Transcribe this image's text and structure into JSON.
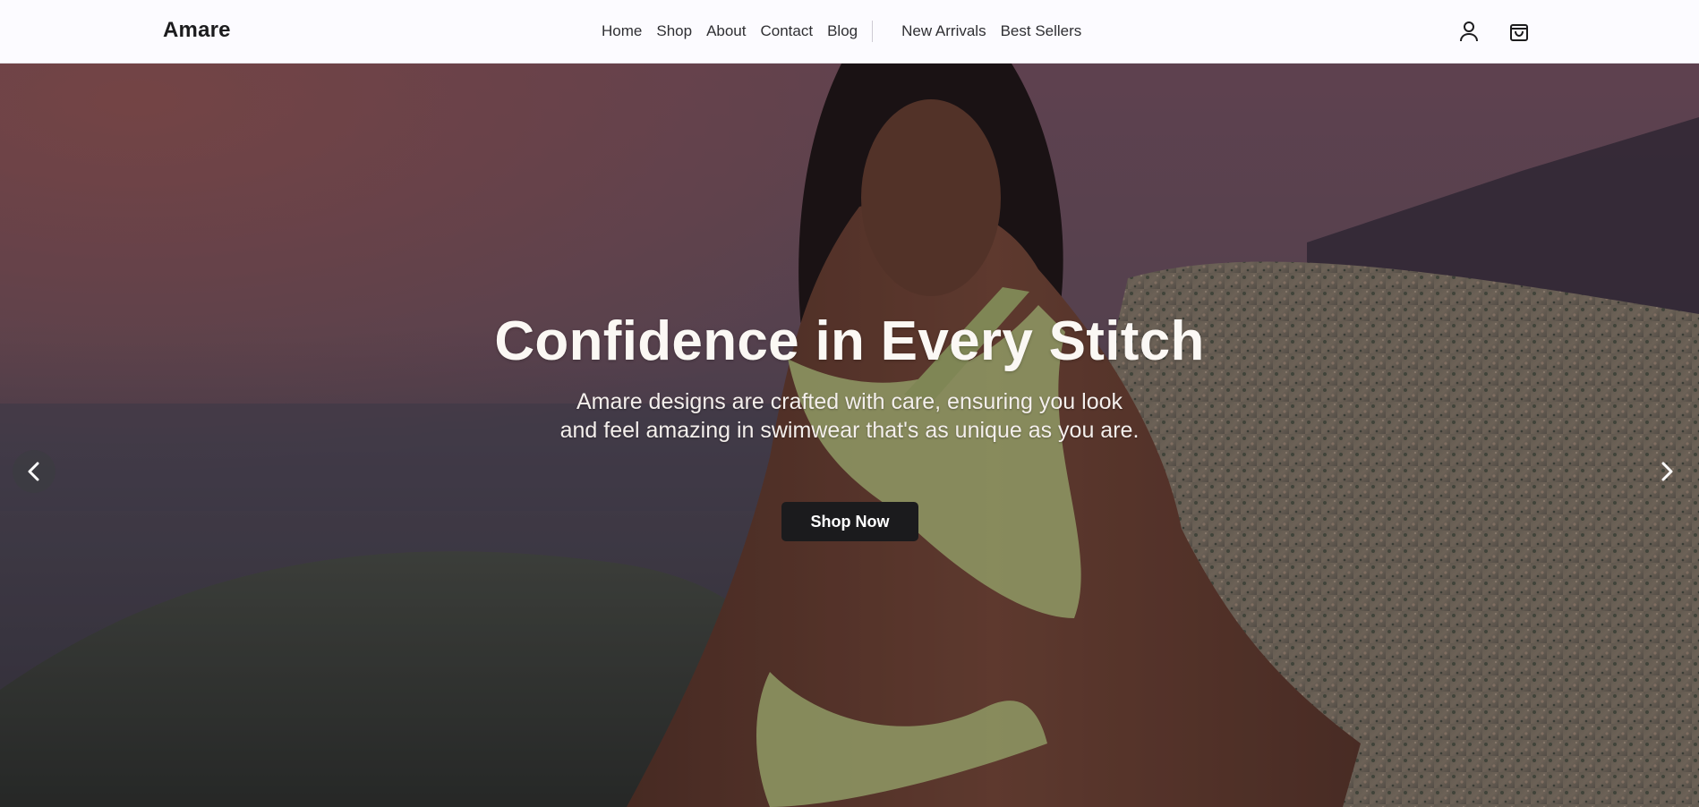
{
  "brand": {
    "name": "Amare"
  },
  "nav": {
    "primary": [
      "Home",
      "Shop",
      "About",
      "Contact",
      "Blog"
    ],
    "secondary": [
      "New Arrivals",
      "Best Sellers"
    ]
  },
  "header_icons": {
    "account": "user-icon",
    "cart": "shopping-bag-icon"
  },
  "hero": {
    "headline": "Confidence in Every Stitch",
    "subtext_line1": "Amare designs are crafted with care, ensuring you look",
    "subtext_line2": "and feel amazing in swimwear that's as unique as you are.",
    "cta_label": "Shop Now",
    "prev_icon": "chevron-left-icon",
    "next_icon": "chevron-right-icon",
    "image_subject": "model-in-lime-bikini-on-granite-rocks-at-dusk"
  },
  "colors": {
    "header_bg": "#fcfbff",
    "text_dark": "#1c1c1e",
    "cta_bg": "#1b1b1d",
    "bikini": "#b8c47c",
    "sky": "#7a5a6a",
    "rock": "#8a7a68"
  }
}
